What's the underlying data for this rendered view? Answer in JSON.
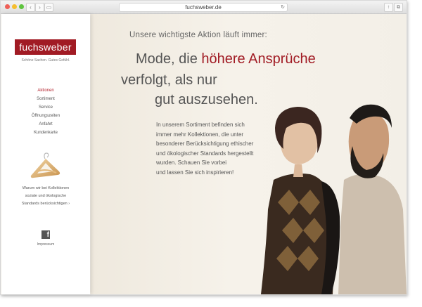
{
  "browser": {
    "url": "fuchsweber.de",
    "back_icon": "chevron-left-icon",
    "forward_icon": "chevron-right-icon",
    "sidebar_icon": "sidebar-icon",
    "reload_icon": "reload-icon",
    "share_icon": "share-icon",
    "tabs_icon": "tabs-icon"
  },
  "sidebar": {
    "logo": "fuchsweber",
    "tagline": "Schöne Sachen. Gutes Gefühl.",
    "nav": [
      {
        "label": "Aktionen",
        "active": true
      },
      {
        "label": "Sortiment"
      },
      {
        "label": "Service"
      },
      {
        "label": "Öffnungszeiten"
      },
      {
        "label": "Anfahrt"
      },
      {
        "label": "Kundenkarte"
      }
    ],
    "promo": {
      "line1": "Warum wir bei Kollektionen",
      "line2": "soziale und ökologische",
      "line3": "Standards berücksichtigen ›"
    },
    "facebook_icon": "facebook-icon",
    "impressum": "Impressum"
  },
  "main": {
    "eyebrow": "Unsere wichtigste Aktion läuft immer:",
    "headline": {
      "line1_a": "Mode, die ",
      "line1_b": "höhere Ansprüche",
      "line2": "verfolgt, als nur",
      "line3": "gut auszusehen."
    },
    "body": [
      "In unserem Sortiment befinden sich",
      "immer mehr Kollektionen, die unter",
      "besonderer Berücksichtigung ethischer",
      "und ökologischer Standards hergestellt",
      "wurden. Schauen Sie vorbei",
      "und lassen Sie sich inspirieren!"
    ]
  },
  "colors": {
    "brand": "#a11b24",
    "background": "#f4f0e8",
    "text": "#555555"
  }
}
